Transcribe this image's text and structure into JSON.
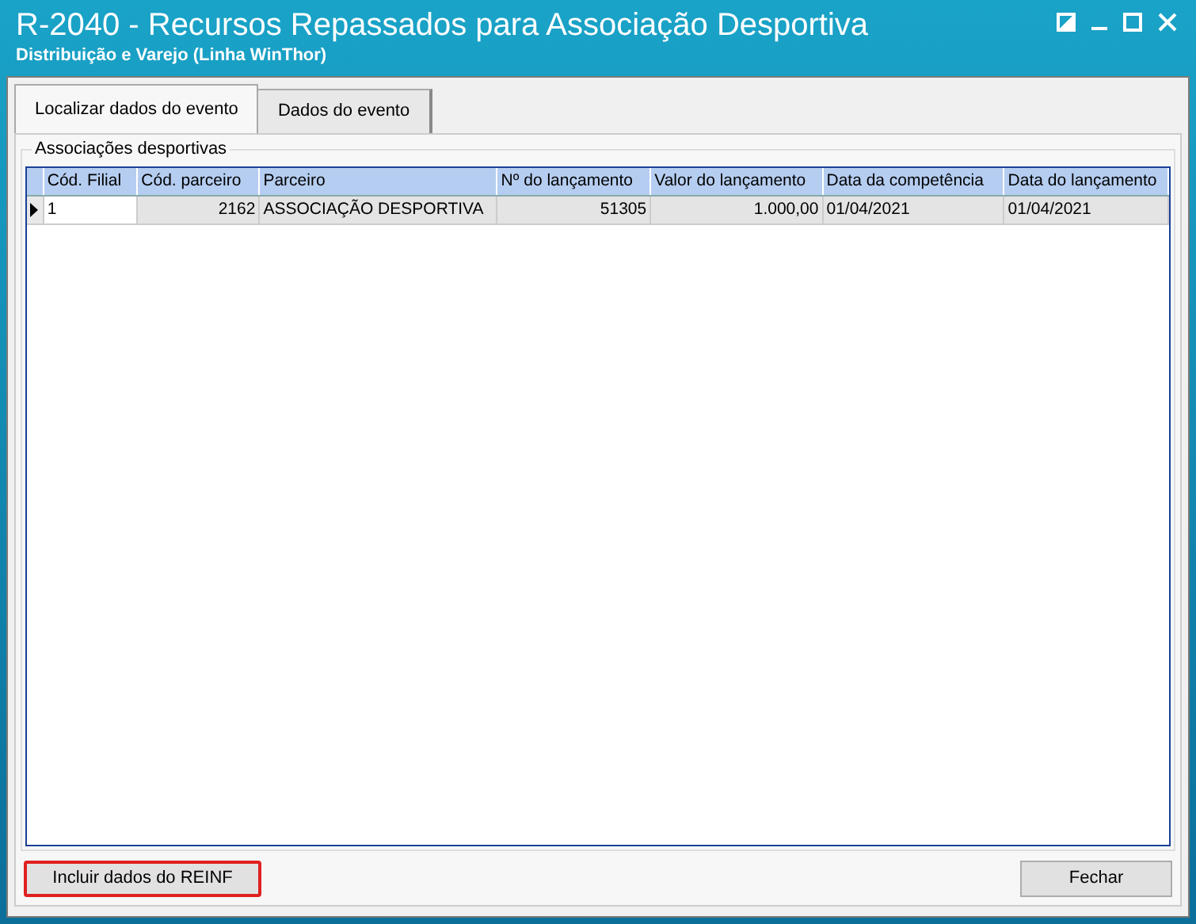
{
  "window": {
    "title": "R-2040 - Recursos Repassados para Associação Desportiva",
    "subtitle": "Distribuição e Varejo (Linha WinThor)"
  },
  "tabs": [
    {
      "label": "Localizar dados do evento",
      "selected": true
    },
    {
      "label": "Dados do evento",
      "selected": false
    }
  ],
  "group": {
    "title": "Associações desportivas"
  },
  "table": {
    "columns": [
      "Cód. Filial",
      "Cód. parceiro",
      "Parceiro",
      "Nº do lançamento",
      "Valor do lançamento",
      "Data da competência",
      "Data do lançamento"
    ],
    "rows": [
      {
        "selected": true,
        "cells": [
          "1",
          "2162",
          "ASSOCIAÇÃO DESPORTIVA",
          "51305",
          "1.000,00",
          "01/04/2021",
          "01/04/2021"
        ]
      }
    ]
  },
  "buttons": [
    {
      "label": "Incluir dados do REINF",
      "highlighted": true
    },
    {
      "label": "Fechar",
      "highlighted": false
    }
  ]
}
